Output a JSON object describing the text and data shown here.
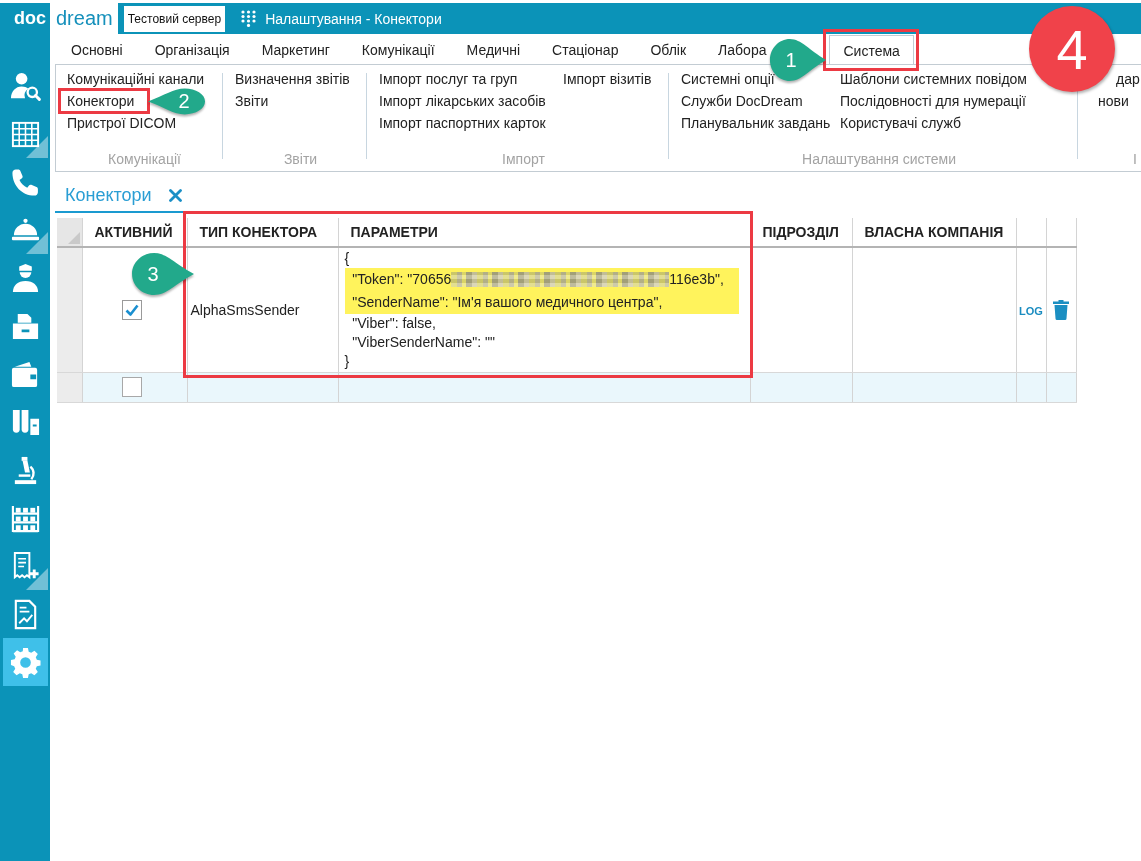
{
  "header": {
    "logo": {
      "part_1": "doc",
      "part_2": "dream"
    },
    "server_badge": "Тестовий сервер",
    "title": "Налаштування - Конектори"
  },
  "sidebar": {
    "items": [
      {
        "selected": false,
        "has_submenu": false
      },
      {
        "selected": false,
        "has_submenu": true
      },
      {
        "selected": false,
        "has_submenu": false
      },
      {
        "selected": false,
        "has_submenu": true
      },
      {
        "selected": false,
        "has_submenu": false
      },
      {
        "selected": false,
        "has_submenu": false
      },
      {
        "selected": false,
        "has_submenu": false
      },
      {
        "selected": false,
        "has_submenu": false
      },
      {
        "selected": false,
        "has_submenu": false
      },
      {
        "selected": false,
        "has_submenu": false
      },
      {
        "selected": false,
        "has_submenu": true
      },
      {
        "selected": false,
        "has_submenu": false
      },
      {
        "selected": true,
        "has_submenu": false
      }
    ]
  },
  "ribbon": {
    "tabs": [
      {
        "label": "Основні",
        "selected": false
      },
      {
        "label": "Організація",
        "selected": false
      },
      {
        "label": "Маркетинг",
        "selected": false
      },
      {
        "label": "Комунікації",
        "selected": false
      },
      {
        "label": "Медичні",
        "selected": false
      },
      {
        "label": "Стаціонар",
        "selected": false
      },
      {
        "label": "Облік",
        "selected": false
      },
      {
        "label": "Лабора",
        "selected": false
      },
      {
        "label": "Система",
        "selected": true
      }
    ],
    "groups": [
      {
        "label": "Комунікації",
        "columns": [
          [
            "Комунікаційні канали",
            "Конектори",
            "Пристрої DICOM"
          ]
        ]
      },
      {
        "label": "Звіти",
        "columns": [
          [
            "Визначення звітів",
            "Звіти"
          ]
        ]
      },
      {
        "label": "Імпорт",
        "columns": [
          [
            "Імпорт послуг та груп",
            "Імпорт лікарських засобів",
            "Імпорт паспортних карток"
          ],
          [
            "Імпорт візитів"
          ]
        ]
      },
      {
        "label": "Налаштування системи",
        "columns": [
          [
            "Системні опції",
            "Служби DocDream",
            "Планувальник завдань"
          ],
          [
            "Шаблони системних повідом",
            "Послідовності для нумерації",
            "Користувачі служб"
          ]
        ]
      },
      {
        "label": "І",
        "columns": [
          [
            "дар",
            "нови"
          ]
        ]
      }
    ]
  },
  "document_tab": {
    "label": "Конектори"
  },
  "table": {
    "columns": [
      "АКТИВНИЙ",
      "ТИП КОНЕКТОРА",
      "ПАРАМЕТРИ",
      "ПІДРОЗДІЛ",
      "ВЛАСНА КОМПАНІЯ"
    ],
    "rows": [
      {
        "kind": "entry",
        "active": true,
        "connector_type": "AlphaSmsSender",
        "parameters": [
          {
            "text": "{",
            "highlighted": false,
            "redacted": false
          },
          {
            "text": "  \"Token\": \"70656",
            "highlighted": true,
            "redacted": true,
            "text_after": "116e3b\","
          },
          {
            "text": "  \"SenderName\": \"Ім'я вашого медичного центра\",",
            "highlighted": true,
            "redacted": false
          },
          {
            "text": "  \"Viber\": false,",
            "highlighted": false,
            "redacted": false
          },
          {
            "text": "  \"ViberSenderName\": \"\"",
            "highlighted": false,
            "redacted": false
          },
          {
            "text": "}",
            "highlighted": false,
            "redacted": false
          }
        ],
        "log_link": "LOG"
      },
      {
        "kind": "new_row",
        "active": false
      }
    ]
  },
  "annotations": [
    {
      "kind": "frame"
    },
    {
      "kind": "callout",
      "label": "1",
      "tail_left": false
    },
    {
      "kind": "badge",
      "label": "4"
    },
    {
      "kind": "frame"
    },
    {
      "kind": "callout",
      "label": "2",
      "tail_left": true
    },
    {
      "kind": "frame"
    },
    {
      "kind": "callout",
      "label": "3",
      "tail_left": false
    }
  ]
}
